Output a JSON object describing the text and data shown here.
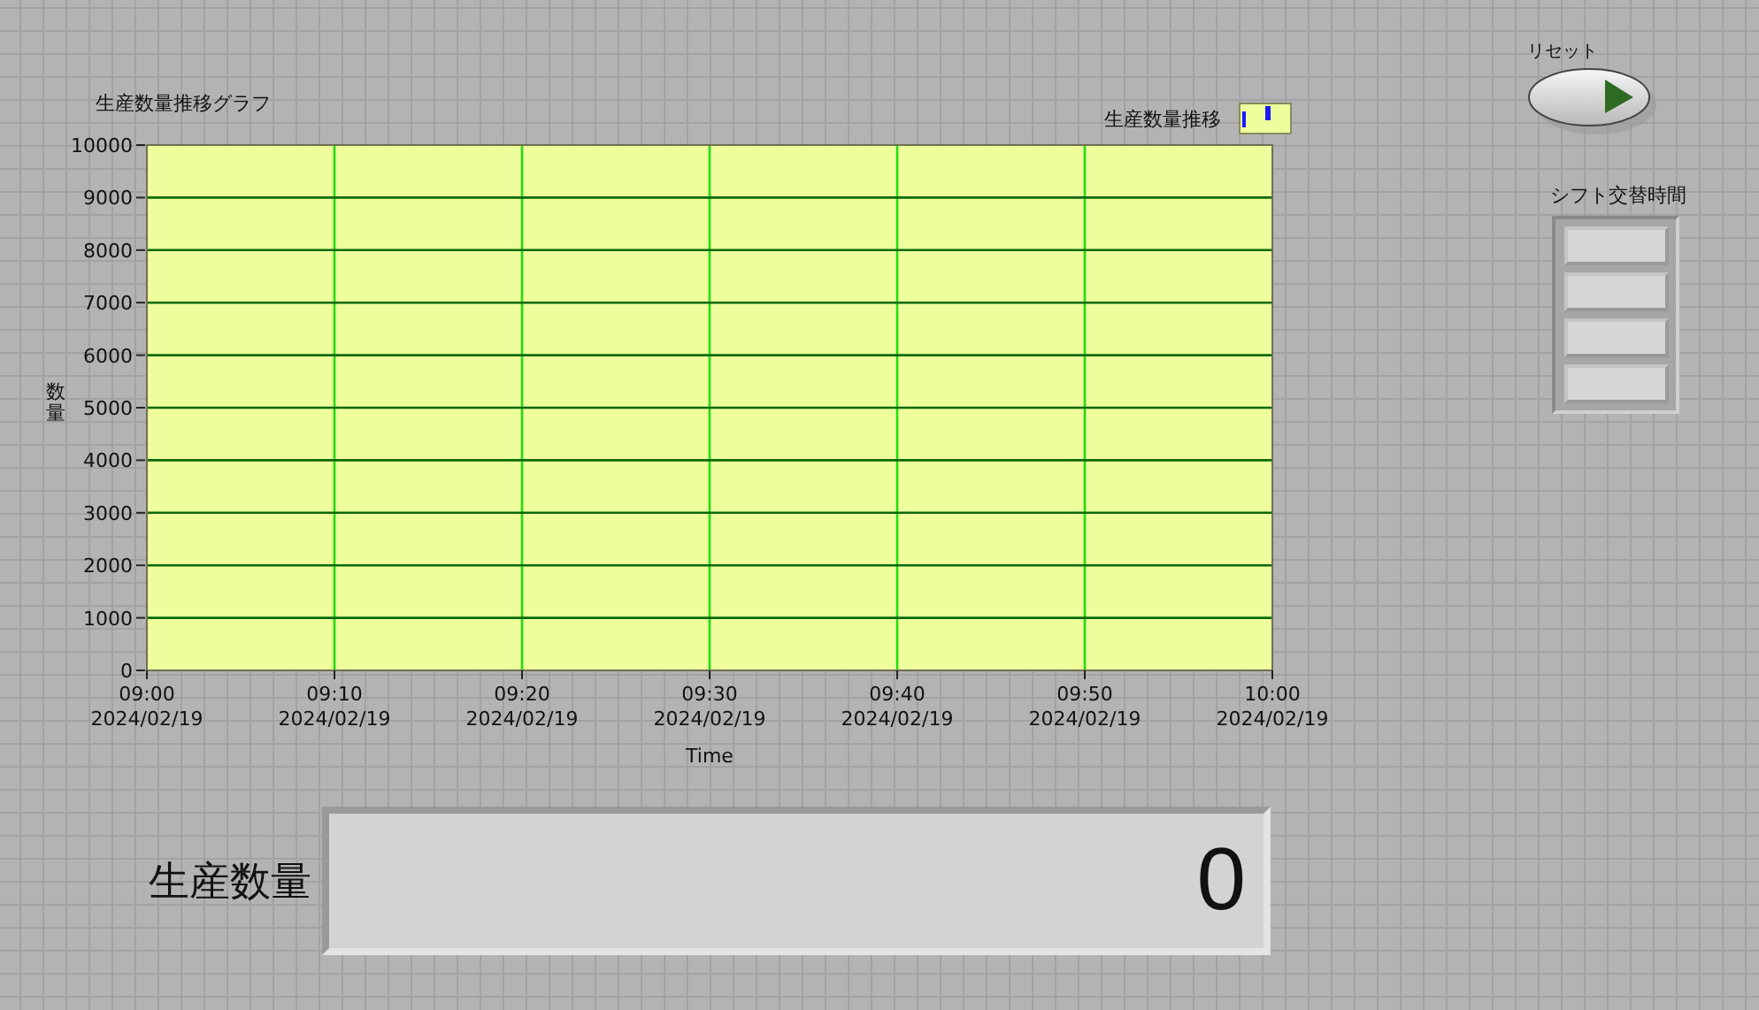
{
  "graph": {
    "legend": {
      "label": "生産数量推移",
      "color": "#1a1aff"
    },
    "chart_data": {
      "type": "line",
      "title": "生産数量推移グラフ",
      "xlabel": "Time",
      "ylabel": "数量",
      "grid": true,
      "ylim": [
        0,
        10000
      ],
      "yticks": [
        0,
        1000,
        2000,
        3000,
        4000,
        5000,
        6000,
        7000,
        8000,
        9000,
        10000
      ],
      "categories": [
        "09:00 2024/02/19",
        "09:10 2024/02/19",
        "09:20 2024/02/19",
        "09:30 2024/02/19",
        "09:40 2024/02/19",
        "09:50 2024/02/19",
        "10:00 2024/02/19"
      ]
    }
  },
  "reset_button": {
    "label": "リセット"
  },
  "shift_array": {
    "label": "シフト交替時間"
  },
  "production_count": {
    "label": "生産数量",
    "value": "0"
  }
}
